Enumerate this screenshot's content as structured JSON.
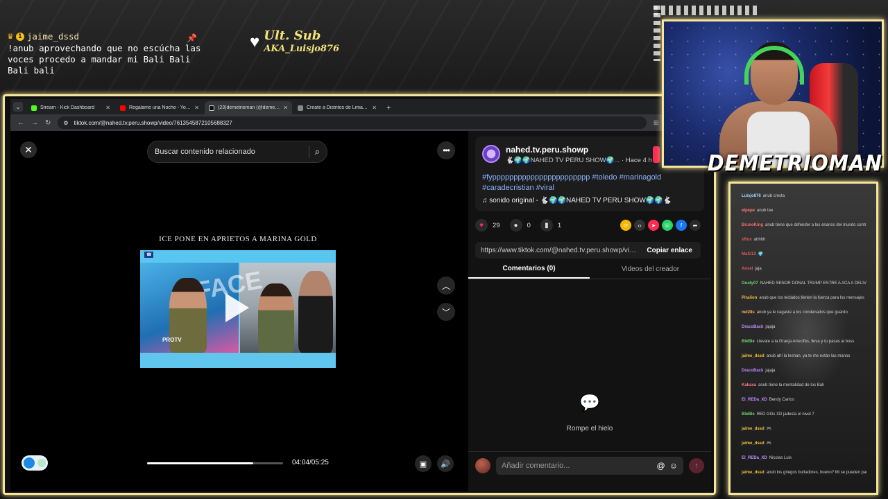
{
  "overlay": {
    "chat_top": {
      "username": "jaime_dssd",
      "badge": "1",
      "message": "!anub aprovechando que no escúcha las voces procedo a mandar mi Bali Bali Bali bali"
    },
    "last_sub": {
      "title": "Ult. Sub",
      "name": "AKA_Luisjo876"
    },
    "streamer_name": "DEMETRIOMAN",
    "frame_color": "#f6e69a"
  },
  "browser": {
    "tabs": [
      {
        "label": "Stream - Kick Dashboard",
        "color": "#53fc18",
        "active": false
      },
      {
        "label": "Regalame una Noche - YouTube",
        "color": "#ff0000",
        "active": false
      },
      {
        "label": "(23)demetrioman (@demetrioman)",
        "color": "#111111",
        "active": true
      },
      {
        "label": "Create a Distritos de Lima Peru",
        "color": "#888888",
        "active": false
      }
    ],
    "url": "tiktok.com/@nahed.tv.peru.showp/video/7613545872105688327"
  },
  "tiktok": {
    "search_placeholder": "Buscar contenido relacionado",
    "video_title": "ICE PONE EN APRIETOS A MARINA GOLD",
    "video_logo": "PROTV",
    "time": "04:04/05:25",
    "progress": 0.78,
    "creator": {
      "name": "nahed.tv.peru.showp",
      "subtitle": "🐇🌍🌍NAHED TV PERU SHOW🌍... · Hace 4 h",
      "caption": "#fyppppppppppppppppppppppp #toledo #marinagold #caradecristian #viral",
      "sound": "sonido original - 🐇🌍🌍NAHED TV PERU SHOW🌍🌍🐇"
    },
    "stats": {
      "likes": "29",
      "comments": "0",
      "saves": "1"
    },
    "share_link": "https://www.tiktok.com/@nahed.tv.peru.showp/vid...",
    "copy_label": "Copiar enlace",
    "tabs": [
      "Comentarios (0)",
      "Videos del creador"
    ],
    "empty_text": "Rompe el hielo",
    "comment_placeholder": "Añadir comentario..."
  },
  "chat": [
    {
      "user": "Luisjo876",
      "text": "anub cresta",
      "color": "#a0d8ff"
    },
    {
      "user": "elpepe",
      "text": "anub tee",
      "color": "#ff7a7a"
    },
    {
      "user": "BrunoKing",
      "text": "anub tiene que defender a los enanos del mundo contra el bang bang",
      "color": "#ff6b6b"
    },
    {
      "user": "xRox",
      "text": "ahhhh",
      "color": "#e05d5d"
    },
    {
      "user": "MaXi12",
      "text": "🌍",
      "color": "#e05d5d"
    },
    {
      "user": "Ansel",
      "text": "jaja",
      "color": "#e05d5d"
    },
    {
      "user": "Goaty07",
      "text": "NAHED SEÑOR DONAL TRUMP ENTRE A ACA A DELIVER DE UN MISIL INTERCONTINENTAL CON UN RAPTOR F22",
      "color": "#6fd46f"
    },
    {
      "user": "Pirañon",
      "text": "anub que los teclados tienen la fuerza para los mensajes",
      "color": "#f0c040"
    },
    {
      "user": "nel28s",
      "text": "anub ya le cagaste a los condenados que guardo",
      "color": "#ffb060"
    },
    {
      "user": "DracoBack",
      "text": "jajaja",
      "color": "#c28bff"
    },
    {
      "user": "BleBle",
      "text": "Llevate a la Granja Arrecifes, lleva y tu pasas al boss",
      "color": "#6fd46f"
    },
    {
      "user": "jaime_dssd",
      "text": "anub ahí la leshan, ya te me están las manos",
      "color": "#f0c040"
    },
    {
      "user": "DracoBack",
      "text": "jajaja",
      "color": "#c28bff"
    },
    {
      "user": "Kakaxa",
      "text": "anub tiene la mentalidad de los Bali",
      "color": "#ff7a7a"
    },
    {
      "user": "El_REDa_XD",
      "text": "Bendy Carlos",
      "color": "#c28bff"
    },
    {
      "user": "BleBle",
      "text": "RED GGs XD jadesta el nivel 7",
      "color": "#6fd46f"
    },
    {
      "user": "jaime_dssd",
      "text": "🎮",
      "color": "#f0c040"
    },
    {
      "user": "jaime_dssd",
      "text": "🎮",
      "color": "#f0c040"
    },
    {
      "user": "El_REDa_XD",
      "text": "Nicolas Luis",
      "color": "#c28bff"
    },
    {
      "user": "jaime_dssd",
      "text": "anub los griegos burladores, bueno? Mi se pueden parar en su fila por la grasa que tienen y hacer lo que aprieten",
      "color": "#f0c040"
    }
  ]
}
